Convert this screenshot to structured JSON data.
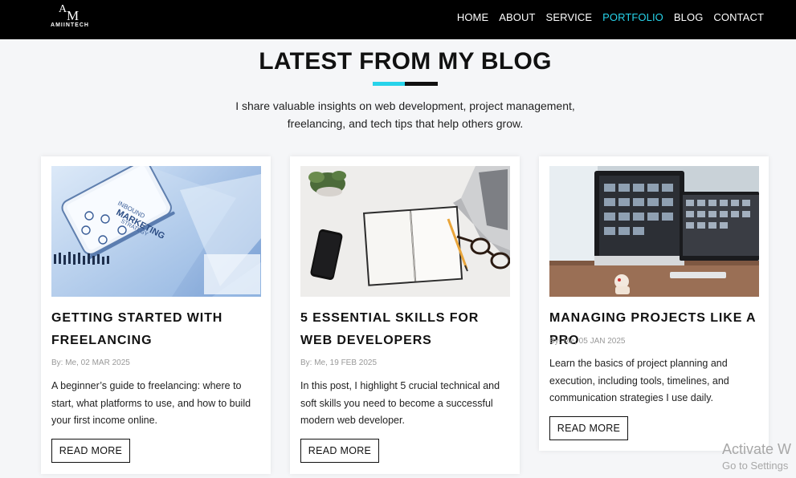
{
  "nav": {
    "logo_mark_a": "A",
    "logo_mark_m": "M",
    "logo_text": "AMIINTECH",
    "links": [
      {
        "label": "HOME",
        "active": false
      },
      {
        "label": "ABOUT",
        "active": false
      },
      {
        "label": "SERVICE",
        "active": false
      },
      {
        "label": "PORTFOLIO",
        "active": true
      },
      {
        "label": "BLOG",
        "active": false
      },
      {
        "label": "CONTACT",
        "active": false
      }
    ],
    "active_color": "#27d3ea"
  },
  "section": {
    "title": "LATEST FROM MY BLOG",
    "subtitle": "I share valuable insights on web development, project management, freelancing, and tech tips that help others grow."
  },
  "posts": [
    {
      "title": "GETTING STARTED WITH FREELANCING",
      "meta": "By: Me, 02 MAR 2025",
      "description": "A beginner’s guide to freelancing: where to start, what platforms to use, and how to build your first income online.",
      "button": "READ MORE",
      "image": "phone-marketing-strategy-image"
    },
    {
      "title": "5 ESSENTIAL SKILLS FOR WEB DEVELOPERS",
      "meta": "By: Me, 19 FEB 2025",
      "description": "In this post, I highlight 5 crucial technical and soft skills you need to become a successful modern web developer.",
      "button": "READ MORE",
      "image": "desk-notebook-image"
    },
    {
      "title": "MANAGING PROJECTS LIKE A PRO",
      "meta": "By: Me, 05 JAN 2025",
      "description": "Learn the basics of project planning and execution, including tools, timelines, and communication strategies I use daily.",
      "button": "READ MORE",
      "image": "monitors-desk-image"
    }
  ],
  "watermark": {
    "line1": "Activate W",
    "line2": "Go to Settings"
  }
}
